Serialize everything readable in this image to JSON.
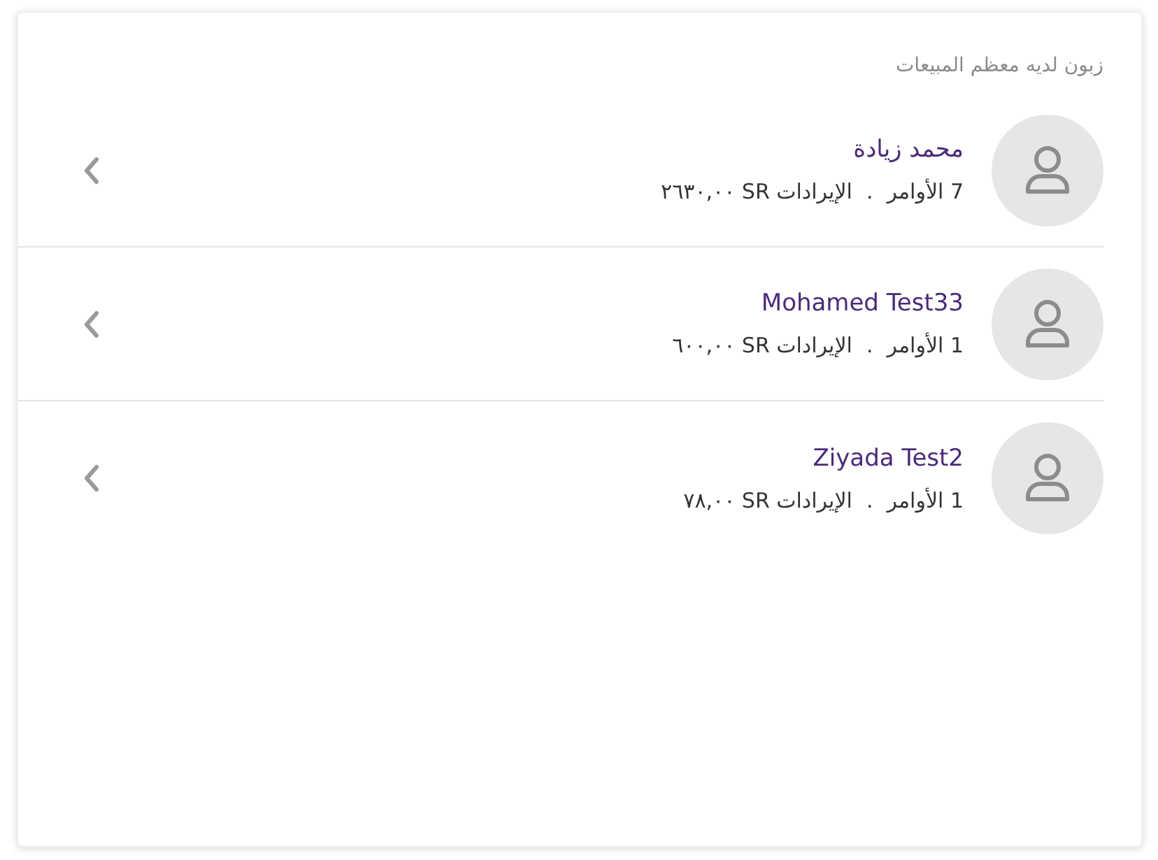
{
  "card": {
    "title": "زبون لديه معظم المبيعات"
  },
  "customers": [
    {
      "name": "محمد زيادة",
      "orders": "7 الأوامر",
      "separator": ".",
      "revenue": "الإيرادات SR ٢٦٣٠,٠٠"
    },
    {
      "name": "Mohamed Test33",
      "orders": "1 الأوامر",
      "separator": ".",
      "revenue": "الإيرادات SR ٦٠٠,٠٠"
    },
    {
      "name": "Ziyada Test2",
      "orders": "1 الأوامر",
      "separator": ".",
      "revenue": "الإيرادات SR ٧٨,٠٠"
    }
  ]
}
